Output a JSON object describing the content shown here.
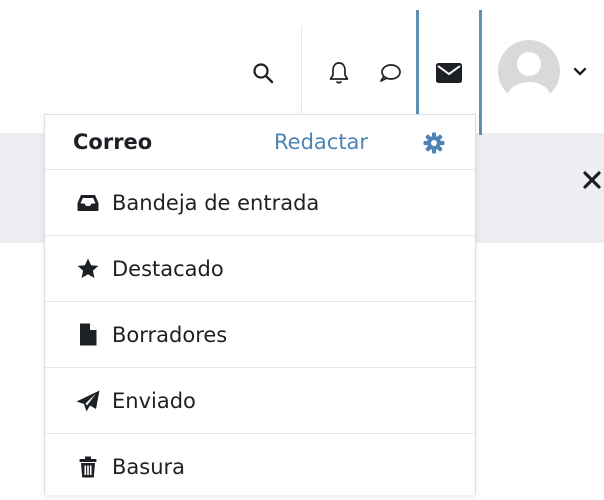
{
  "navbar": {
    "icons": [
      "search-icon",
      "bell-icon",
      "chat-icon",
      "envelope-icon",
      "avatar",
      "chevron-down-icon"
    ]
  },
  "popover": {
    "title": "Correo",
    "compose_label": "Redactar",
    "settings_icon": "gear-icon",
    "items": [
      {
        "label": "Bandeja de entrada",
        "icon": "inbox-icon"
      },
      {
        "label": "Destacado",
        "icon": "star-icon"
      },
      {
        "label": "Borradores",
        "icon": "file-icon"
      },
      {
        "label": "Enviado",
        "icon": "paper-plane-icon"
      },
      {
        "label": "Basura",
        "icon": "trash-icon"
      }
    ]
  },
  "colors": {
    "accent": "#4d83b5",
    "active_border": "#5f8fb1",
    "page_band": "#eceef3",
    "text": "#1d2125"
  }
}
